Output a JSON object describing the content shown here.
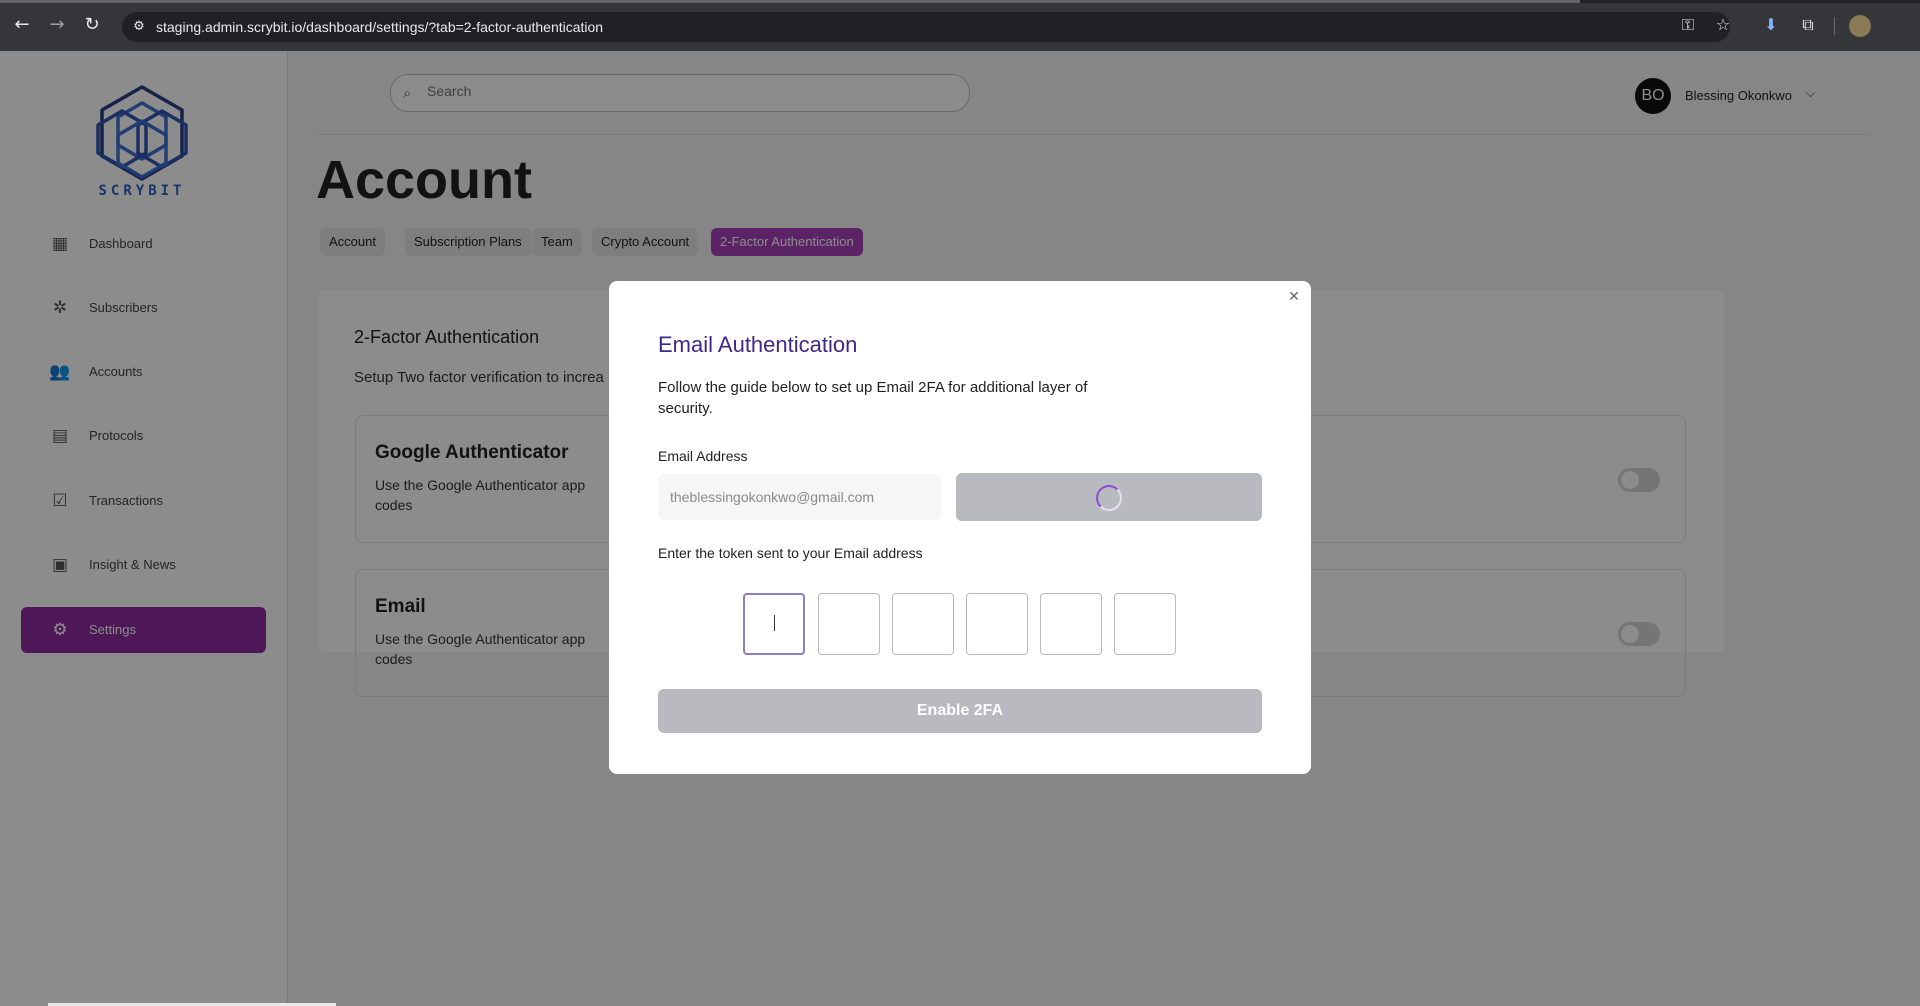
{
  "browser": {
    "url": "staging.admin.scrybit.io/dashboard/settings/?tab=2-factor-authentication",
    "icons": [
      "back-icon",
      "forward-icon",
      "reload-icon",
      "site-info-icon",
      "password-key-icon",
      "bookmark-star-icon",
      "download-icon",
      "extensions-icon",
      "profile-avatar"
    ]
  },
  "sidebar": {
    "logo_text": "SCRYBIT",
    "items": [
      {
        "label": "Dashboard",
        "icon": "dashboard-icon",
        "glyph": "▦",
        "active": false
      },
      {
        "label": "Subscribers",
        "icon": "subscribers-icon",
        "glyph": "✲",
        "active": false
      },
      {
        "label": "Accounts",
        "icon": "accounts-icon",
        "glyph": "👥",
        "active": false
      },
      {
        "label": "Protocols",
        "icon": "protocols-icon",
        "glyph": "▤",
        "active": false
      },
      {
        "label": "Transactions",
        "icon": "transactions-icon",
        "glyph": "☑",
        "active": false
      },
      {
        "label": "Insight & News",
        "icon": "news-icon",
        "glyph": "▣",
        "active": false
      },
      {
        "label": "Settings",
        "icon": "gear-icon",
        "glyph": "⚙",
        "active": true
      }
    ]
  },
  "header": {
    "search_placeholder": "Search",
    "user_initials": "BO",
    "user_name": "Blessing Okonkwo"
  },
  "main": {
    "title": "Account",
    "tabs": [
      "Account",
      "Subscription Plans",
      "Team",
      "Crypto Account",
      "2-Factor Authentication"
    ],
    "active_tab": "2-Factor Authentication",
    "card": {
      "heading": "2-Factor Authentication",
      "subtitle": "Setup Two factor verification to increa",
      "options": [
        {
          "title": "Google Authenticator",
          "desc": "Use the Google Authenticator app codes",
          "enabled": false
        },
        {
          "title": "Email",
          "desc": "Use the Google Authenticator app codes",
          "enabled": false
        }
      ]
    }
  },
  "modal": {
    "title": "Email Authentication",
    "description": "Follow the guide below to set up Email 2FA for additional layer of security.",
    "email_label": "Email Address",
    "email_value": "theblessingokonkwo@gmail.com",
    "send_button_state": "loading",
    "token_label": "Enter the token sent to your Email address",
    "otp_digits": [
      "",
      "",
      "",
      "",
      "",
      ""
    ],
    "submit_label": "Enable 2FA"
  },
  "colors": {
    "accent": "#8e2a9e",
    "active_tab": "#a83fbb",
    "modal_title": "#3e2a86",
    "disabled_button": "#b8bac0",
    "logo_blue": "#2b63c4"
  }
}
